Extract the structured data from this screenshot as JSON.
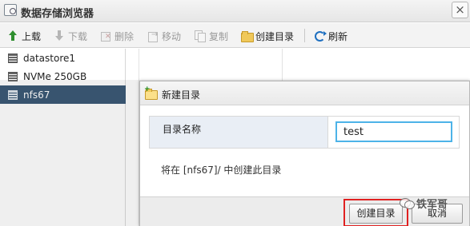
{
  "window": {
    "title": "数据存储浏览器",
    "close_glyph": "×"
  },
  "toolbar": {
    "upload": "上载",
    "download": "下载",
    "delete": "删除",
    "move": "移动",
    "copy": "复制",
    "create_dir": "创建目录",
    "refresh": "刷新"
  },
  "datastores": [
    {
      "name": "datastore1",
      "selected": false
    },
    {
      "name": "NVMe 250GB",
      "selected": false
    },
    {
      "name": "nfs67",
      "selected": true
    }
  ],
  "dialog": {
    "title": "新建目录",
    "field_label": "目录名称",
    "field_value": "test",
    "note": "将在 [nfs67]/ 中创建此目录",
    "create_button": "创建目录",
    "cancel_button": "取消",
    "highlight_color": "#e02020"
  },
  "watermark": {
    "text": "铁军哥"
  },
  "colors": {
    "selected_row": "#2f4f6e",
    "input_focus": "#4db3e8"
  }
}
